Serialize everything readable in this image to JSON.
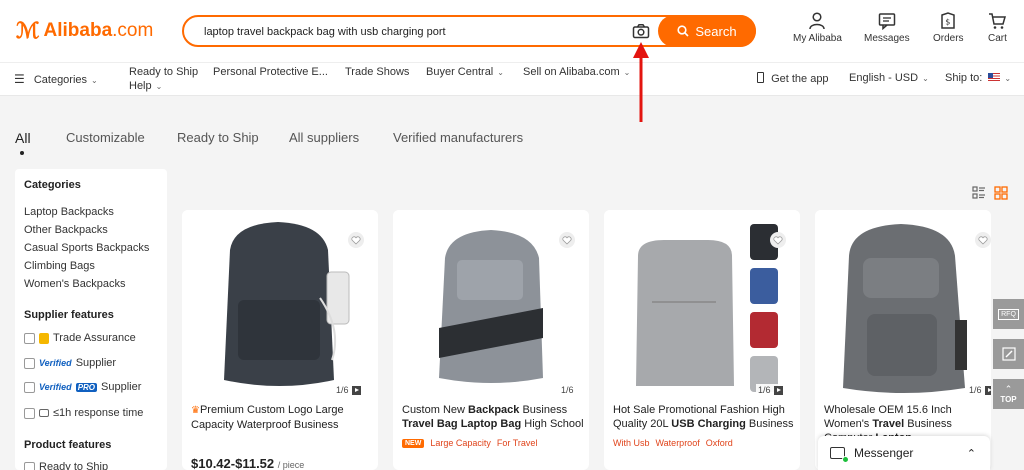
{
  "brand": {
    "name": "Alibaba",
    "suffix": ".com",
    "color": "#ff6a00"
  },
  "search": {
    "value": "laptop travel backpack bag with usb charging port",
    "button_label": "Search"
  },
  "header_actions": [
    {
      "label": "My Alibaba",
      "icon": "user-icon"
    },
    {
      "label": "Messages",
      "icon": "message-icon"
    },
    {
      "label": "Orders",
      "icon": "orders-icon"
    },
    {
      "label": "Cart",
      "icon": "cart-icon"
    }
  ],
  "nav": {
    "categories": "Categories",
    "ready_to_ship": "Ready to Ship",
    "help": "Help",
    "ppe": "Personal Protective E...",
    "trade_shows": "Trade Shows",
    "buyer_central": "Buyer Central",
    "sell": "Sell on Alibaba.com",
    "get_app": "Get the app",
    "language": "English - USD",
    "ship_to": "Ship to:"
  },
  "tabs": [
    "All",
    "Customizable",
    "Ready to Ship",
    "All suppliers",
    "Verified manufacturers"
  ],
  "sidebar": {
    "categories_title": "Categories",
    "categories": [
      "Laptop Backpacks",
      "Other Backpacks",
      "Casual Sports Backpacks",
      "Climbing Bags",
      "Women's Backpacks"
    ],
    "supplier_title": "Supplier features",
    "trade_assurance": "Trade Assurance",
    "verified_badge": "Verified",
    "pro_badge": "PRO",
    "supplier_word": "Supplier",
    "response": "≤1h response time",
    "product_title": "Product features",
    "ready_to_ship": "Ready to Ship"
  },
  "products": [
    {
      "title_parts": [
        "Premium Custom Logo Large Capacity Waterproof Business"
      ],
      "counter": "1/6",
      "price": "$10.42-$11.52",
      "unit": "/ piece",
      "bag_color": "#3a4048"
    },
    {
      "t1": "Custom New ",
      "t2": "Backpack",
      "t3": " Business ",
      "t4": "Travel Bag Laptop Bag",
      "t5": " High School",
      "counter": "1/6",
      "new_tag": "NEW",
      "tags": [
        "Large Capacity",
        "For Travel"
      ],
      "bag_color": "#8d9299"
    },
    {
      "t1": "Hot Sale Promotional Fashion High Quality 20L ",
      "t2": "USB Charging",
      "t3": " Business",
      "counter": "1/6",
      "tags": [
        "With Usb",
        "Waterproof",
        "Oxford"
      ],
      "bag_color": "#a7a9ac"
    },
    {
      "t1": "Wholesale OEM 15.6 Inch Women's ",
      "t2": "Travel",
      "t3": " Business Computer ",
      "t4": "Laptop",
      "counter": "1/6",
      "bag_color": "#6b6e72"
    }
  ],
  "floating": {
    "rfq": "RFQ",
    "top": "TOP"
  },
  "messenger": {
    "label": "Messenger"
  }
}
